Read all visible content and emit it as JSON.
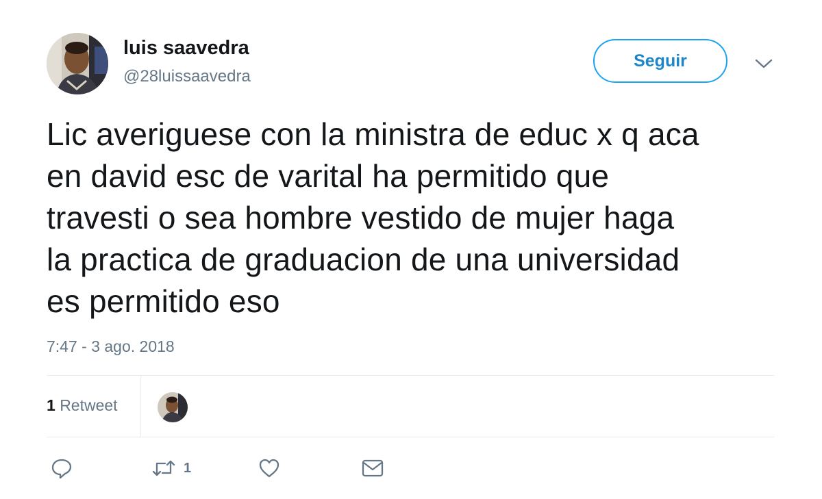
{
  "user": {
    "name": "luis saavedra",
    "handle": "@28luissaavedra"
  },
  "follow_button_label": "Seguir",
  "tweet": {
    "lines": [
      "Lic averiguese con la ministra de educ x q aca",
      "en david esc de varital ha permitido que",
      "travesti o sea hombre vestido de mujer haga",
      "la practica de graduacion de una universidad",
      "es permitido eso"
    ],
    "timestamp": "7:47 - 3 ago. 2018"
  },
  "stats": {
    "retweet_count": "1",
    "retweet_label": "Retweet"
  },
  "actions": {
    "reply_icon": "reply-icon",
    "retweet_icon": "retweet-icon",
    "retweet_count": "1",
    "like_icon": "heart-icon",
    "message_icon": "envelope-icon"
  },
  "colors": {
    "accent": "#1da1f2",
    "text": "#14171a",
    "secondary": "#657786",
    "divider": "#e6ecf0"
  }
}
